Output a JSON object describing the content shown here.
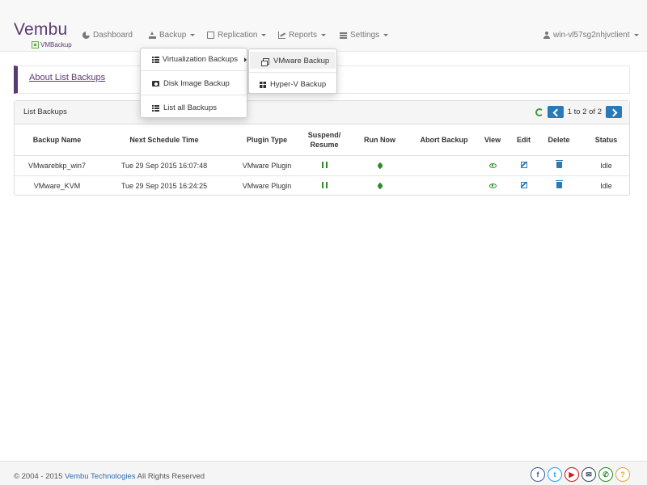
{
  "brand": {
    "name": "Vembu",
    "product": "VMBackup",
    "color": "#5a3a73"
  },
  "nav": {
    "dashboard": "Dashboard",
    "backup": "Backup",
    "replication": "Replication",
    "reports": "Reports",
    "settings": "Settings",
    "user": "win-vl57sg2nhjvclient"
  },
  "backup_menu": {
    "items": [
      {
        "label": "Virtualization Backups",
        "icon": "list-icon"
      },
      {
        "label": "Disk Image Backup",
        "icon": "camera-icon"
      },
      {
        "label": "List all Backups",
        "icon": "list-icon"
      }
    ]
  },
  "virtualization_submenu": {
    "items": [
      {
        "label": "VMware Backup",
        "icon": "vmware-icon"
      },
      {
        "label": "Hyper-V Backup",
        "icon": "windows-icon"
      }
    ]
  },
  "about": {
    "link": "About List Backups"
  },
  "list": {
    "title": "List Backups",
    "pager": "1 to 2 of 2",
    "columns": [
      "Backup Name",
      "Next Schedule Time",
      "Plugin Type",
      "Suspend/ Resume",
      "Run Now",
      "Abort Backup",
      "View",
      "Edit",
      "Delete",
      "Status"
    ],
    "rows": [
      {
        "name": "VMwarebkp_win7",
        "schedule": "Tue 29 Sep 2015 16:07:48",
        "plugin": "VMware Plugin",
        "status": "Idle"
      },
      {
        "name": "VMware_KVM",
        "schedule": "Tue 29 Sep 2015 16:24:25",
        "plugin": "VMware Plugin",
        "status": "Idle"
      }
    ]
  },
  "footer": {
    "copyright_prefix": "© 2004 - 2015",
    "company": "Vembu Technologies",
    "copyright_suffix": "All Rights Reserved",
    "social": [
      {
        "icon": "facebook-icon",
        "glyph": "f",
        "color": "#3b5998"
      },
      {
        "icon": "twitter-icon",
        "glyph": "t",
        "color": "#1da1f2"
      },
      {
        "icon": "youtube-icon",
        "glyph": "▶",
        "color": "#cc181e"
      },
      {
        "icon": "email-icon",
        "glyph": "✉",
        "color": "#34495e"
      },
      {
        "icon": "phone-icon",
        "glyph": "✆",
        "color": "#2e8b2e"
      },
      {
        "icon": "help-icon",
        "glyph": "?",
        "color": "#f0a030"
      }
    ]
  }
}
